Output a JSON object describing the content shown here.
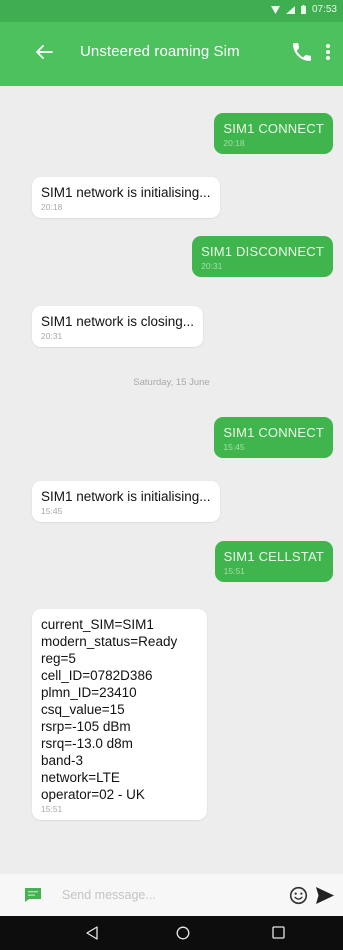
{
  "status_bar": {
    "time": "07:53"
  },
  "app_bar": {
    "title": "Unsteered roaming Sim"
  },
  "messages": [
    {
      "direction": "outgoing",
      "text": "SIM1 CONNECT",
      "time": "20:18"
    },
    {
      "direction": "incoming",
      "text": "SIM1 network is initialising...",
      "time": "20:18"
    },
    {
      "direction": "outgoing",
      "text": "SIM1 DISCONNECT",
      "time": "20:31"
    },
    {
      "direction": "incoming",
      "text": "SIM1 network is closing...",
      "time": "20:31"
    },
    {
      "direction": "outgoing",
      "text": "SIM1 CONNECT",
      "time": "15:45"
    },
    {
      "direction": "incoming",
      "text": "SIM1 network is initialising...",
      "time": "15:45"
    },
    {
      "direction": "outgoing",
      "text": "SIM1 CELLSTAT",
      "time": "15:51"
    },
    {
      "direction": "incoming",
      "text": "current_SIM=SIM1\nmodern_status=Ready\nreg=5\ncell_ID=0782D386\nplmn_ID=23410\ncsq_value=15\nrsrp=-105 dBm\nrsrq=-13.0 d8m\nband-3\nnetwork=LTE\noperator=02 - UK",
      "time": "15:51"
    }
  ],
  "date_separator": "Saturday, 15 June",
  "compose": {
    "placeholder": "Send message..."
  },
  "colors": {
    "status_bar": "#3fae50",
    "app_bar": "#4cc15d",
    "outgoing_bubble": "#40b54d",
    "incoming_bubble": "#ffffff",
    "background": "#ededed"
  },
  "icons": {
    "app_bar": [
      "back-arrow-icon",
      "phone-icon",
      "more-vert-icon"
    ],
    "status_bar": [
      "wifi-icon",
      "signal-icon",
      "battery-icon"
    ],
    "compose": [
      "message-icon",
      "emoji-icon",
      "send-icon"
    ],
    "nav_bar": [
      "nav-back-icon",
      "nav-home-icon",
      "nav-recents-icon"
    ]
  }
}
